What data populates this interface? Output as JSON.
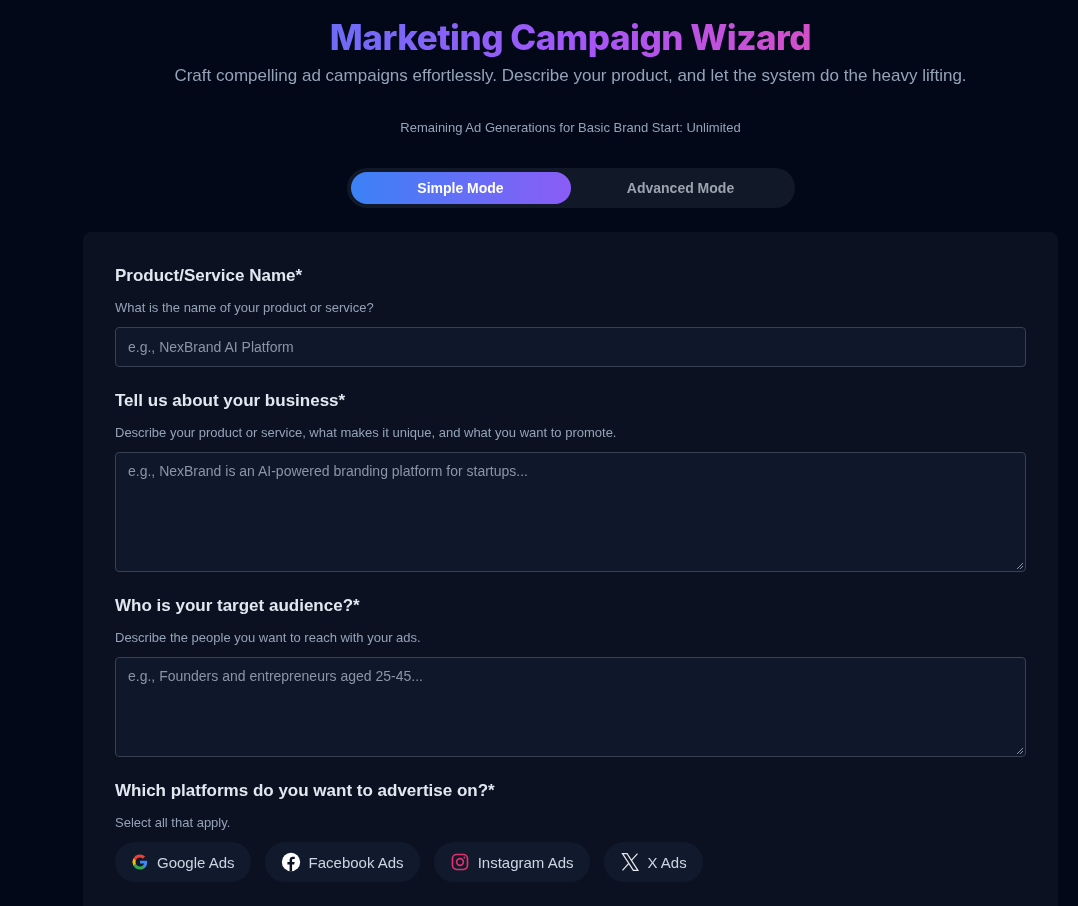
{
  "header": {
    "title": "Marketing Campaign Wizard",
    "subtitle": "Craft compelling ad campaigns effortlessly. Describe your product, and let the system do the heavy lifting.",
    "quota": "Remaining Ad Generations for Basic Brand Start: Unlimited"
  },
  "modes": [
    {
      "label": "Simple Mode",
      "selected": true
    },
    {
      "label": "Advanced Mode",
      "selected": false
    }
  ],
  "fields": [
    {
      "kind": "input",
      "label": "Product/Service Name*",
      "help": "What is the name of your product or service?",
      "placeholder": "e.g., NexBrand AI Platform"
    },
    {
      "kind": "textarea",
      "label": "Tell us about your business*",
      "help": "Describe your product or service, what makes it unique, and what you want to promote.",
      "placeholder": "e.g., NexBrand is an AI-powered branding platform for startups..."
    },
    {
      "kind": "textarea",
      "label": "Who is your target audience?*",
      "help": "Describe the people you want to reach with your ads.",
      "placeholder": "e.g., Founders and entrepreneurs aged 25-45..."
    }
  ],
  "platforms": {
    "label": "Which platforms do you want to advertise on?*",
    "help": "Select all that apply.",
    "options": [
      {
        "kind": "google",
        "label": "Google Ads",
        "selected": false
      },
      {
        "kind": "facebook",
        "label": "Facebook Ads",
        "selected": false
      },
      {
        "kind": "instagram",
        "label": "Instagram Ads",
        "selected": false
      },
      {
        "kind": "x",
        "label": "X Ads",
        "selected": false
      }
    ]
  }
}
